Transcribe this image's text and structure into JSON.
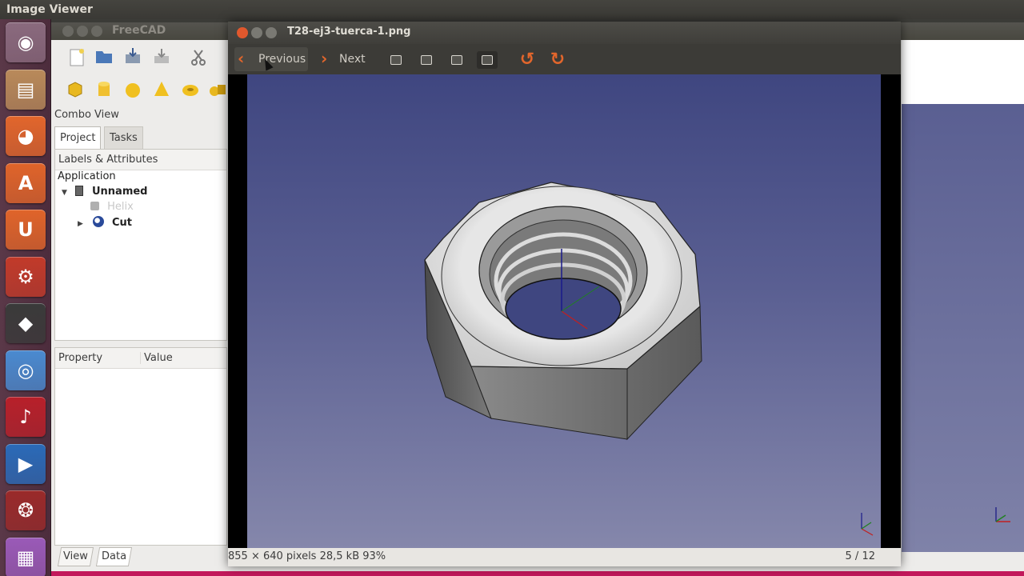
{
  "system": {
    "title": "Image Viewer"
  },
  "launcher": {
    "items": [
      {
        "name": "ubuntu-dash",
        "glyph": "◉",
        "color": "#8a6a7e"
      },
      {
        "name": "file-manager",
        "glyph": "▤",
        "color": "#b98a5a"
      },
      {
        "name": "firefox",
        "glyph": "◕",
        "color": "#e2662c"
      },
      {
        "name": "software-center",
        "glyph": "A",
        "color": "#e0642a"
      },
      {
        "name": "ubuntu-one",
        "glyph": "U",
        "color": "#e0642a"
      },
      {
        "name": "system-settings",
        "glyph": "⚙",
        "color": "#c23a2a"
      },
      {
        "name": "inkscape",
        "glyph": "◆",
        "color": "#3a3a3a"
      },
      {
        "name": "chromium",
        "glyph": "◎",
        "color": "#4a8ad0"
      },
      {
        "name": "audio-recorder",
        "glyph": "♪",
        "color": "#b8202a"
      },
      {
        "name": "media-player",
        "glyph": "▶",
        "color": "#2a6ab8"
      },
      {
        "name": "terminal",
        "glyph": "❂",
        "color": "#9a2a2a"
      },
      {
        "name": "workspace-switcher",
        "glyph": "▦",
        "color": "#9a5ab8"
      }
    ]
  },
  "freecad": {
    "title": "FreeCAD",
    "combo_view": "Combo View",
    "tabs": {
      "project": "Project",
      "tasks": "Tasks"
    },
    "tree_header": "Labels & Attributes",
    "tree": {
      "application": "Application",
      "document": "Unnamed",
      "helix": "Helix",
      "cut": "Cut"
    },
    "property_columns": {
      "property": "Property",
      "value": "Value"
    },
    "bottom_tabs": {
      "view": "View",
      "data": "Data"
    }
  },
  "viewer": {
    "title": "T28-ej3-tuerca-1.png",
    "previous_label": "Previous",
    "next_label": "Next",
    "status_info": "855 × 640 pixels  28,5 kB   93%",
    "status_pages": "5 / 12",
    "image_subject": "hex-nut-3d-render"
  },
  "colors": {
    "accent": "#e2662c",
    "close_button": "#e1582d",
    "viewport_top": "#3f4680",
    "viewport_bottom": "#8587ab"
  }
}
